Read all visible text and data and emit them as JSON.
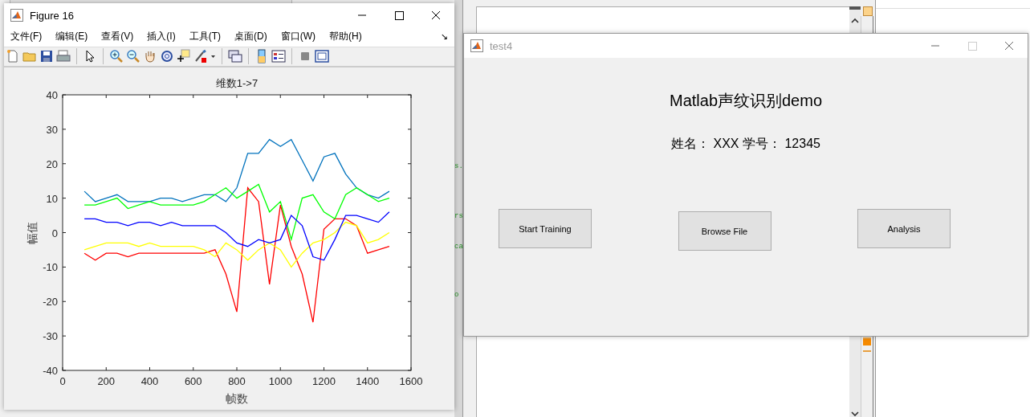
{
  "editor": {
    "code_fragments": [
      "s.",
      "rs",
      "ca",
      "o"
    ]
  },
  "figure_window": {
    "title": "Figure 16",
    "menu": [
      "文件(F)",
      "编辑(E)",
      "查看(V)",
      "插入(I)",
      "工具(T)",
      "桌面(D)",
      "窗口(W)",
      "帮助(H)"
    ],
    "dock_glyph": "↘",
    "chart_data": {
      "type": "line",
      "title": "维数1->7",
      "xlabel": "帧数",
      "ylabel": "幅值",
      "xlim": [
        0,
        1600
      ],
      "ylim": [
        -40,
        40
      ],
      "xticks": [
        0,
        200,
        400,
        600,
        800,
        1000,
        1200,
        1400,
        1600
      ],
      "yticks": [
        -40,
        -30,
        -20,
        -10,
        0,
        10,
        20,
        30,
        40
      ],
      "x": [
        100,
        150,
        200,
        250,
        300,
        350,
        400,
        450,
        500,
        550,
        600,
        650,
        700,
        750,
        800,
        850,
        900,
        950,
        1000,
        1050,
        1100,
        1150,
        1200,
        1250,
        1300,
        1350,
        1400,
        1450,
        1500
      ],
      "series": [
        {
          "color": "#0072bd",
          "values": [
            12,
            9,
            10,
            11,
            9,
            9,
            9,
            10,
            10,
            9,
            10,
            11,
            11,
            9,
            13,
            23,
            23,
            27,
            25,
            27,
            21,
            15,
            22,
            23,
            17,
            13,
            11,
            10,
            12
          ]
        },
        {
          "color": "#ff0000",
          "values": [
            -6,
            -8,
            -6,
            -6,
            -7,
            -6,
            -6,
            -6,
            -6,
            -6,
            -6,
            -6,
            -5,
            -12,
            -23,
            13,
            9,
            -15,
            8,
            -4,
            -12,
            -26,
            1,
            4,
            4,
            2,
            -6,
            -5,
            -4
          ]
        },
        {
          "color": "#ffff00",
          "values": [
            -5,
            -4,
            -3,
            -3,
            -3,
            -4,
            -3,
            -4,
            -4,
            -4,
            -4,
            -5,
            -7,
            -3,
            -5,
            -8,
            -5,
            -3,
            -5,
            -10,
            -6,
            -3,
            -2,
            0,
            3,
            2,
            -3,
            -2,
            0
          ]
        },
        {
          "color": "#00ff00",
          "values": [
            8,
            8,
            9,
            10,
            7,
            8,
            9,
            8,
            8,
            8,
            8,
            9,
            11,
            13,
            10,
            12,
            14,
            6,
            9,
            -2,
            10,
            11,
            6,
            4,
            11,
            13,
            11,
            9,
            10
          ]
        },
        {
          "color": "#0000ff",
          "values": [
            4,
            4,
            3,
            3,
            2,
            3,
            3,
            2,
            3,
            2,
            2,
            2,
            2,
            0,
            -3,
            -4,
            -2,
            -3,
            -2,
            5,
            2,
            -7,
            -8,
            -2,
            5,
            5,
            4,
            3,
            6
          ]
        }
      ]
    }
  },
  "app_window": {
    "title": "test4",
    "heading": "Matlab声纹识别demo",
    "info": "姓名： XXX 学号： 12345",
    "buttons": [
      "Start Training",
      "Browse File",
      "Analysis"
    ]
  }
}
